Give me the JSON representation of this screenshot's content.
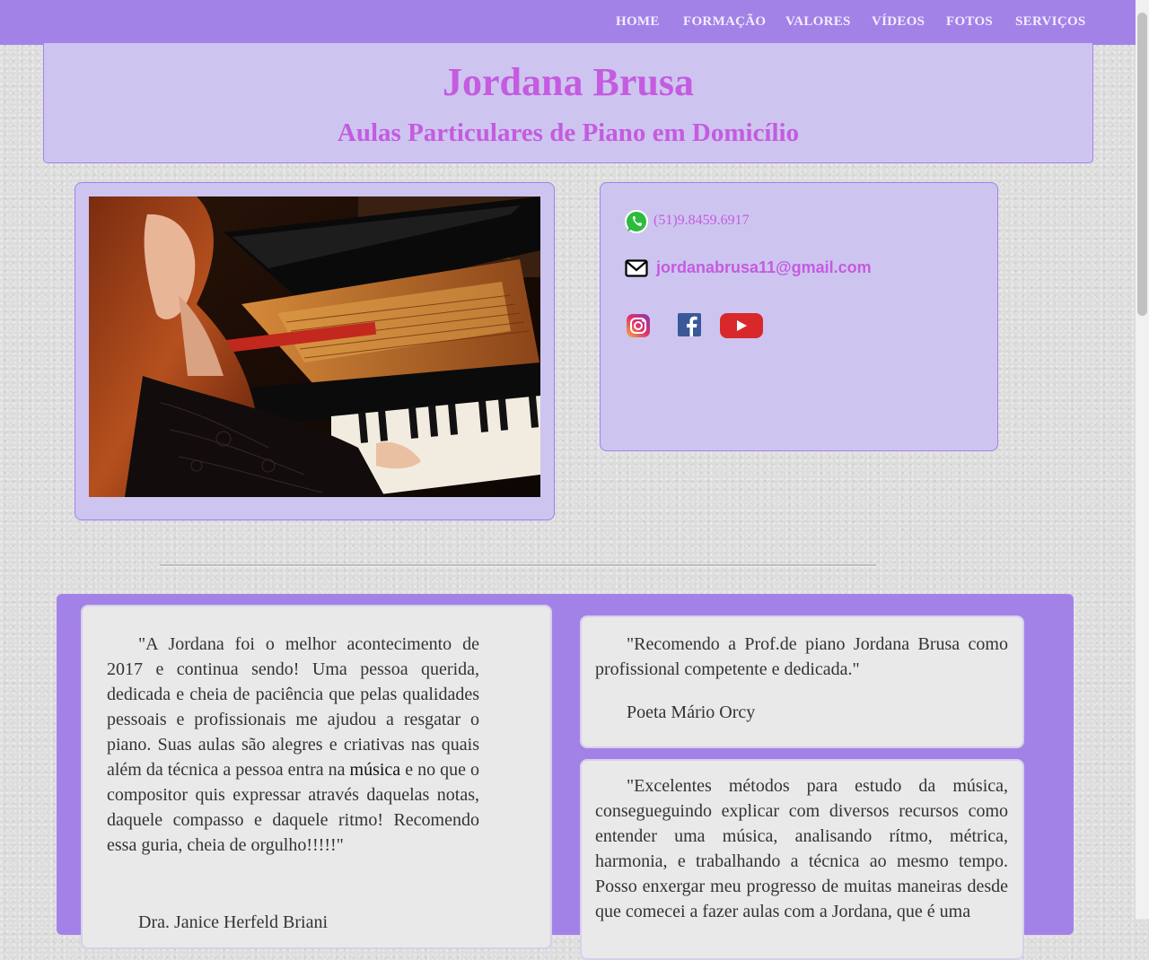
{
  "nav": {
    "items": [
      "HOME",
      "FORMAÇÃO",
      "VALORES",
      "VÍDEOS",
      "FOTOS",
      "SERVIÇOS"
    ]
  },
  "header": {
    "title": "Jordana Brusa",
    "subtitle": "Aulas Particulares de Piano em Domicílio"
  },
  "contact": {
    "phone": "(51)9.8459.6917",
    "email": "jordanabrusa11@gmail.com",
    "social_icons": [
      "instagram-icon",
      "facebook-icon",
      "youtube-icon"
    ]
  },
  "testimonials": [
    {
      "text_before": "\"A Jordana foi o melhor acontecimento de 2017 e continua sendo! Uma pessoa querida, dedicada e cheia de paciência que pelas qualidades pessoais e profissionais me ajudou a resgatar o piano. Suas aulas são alegres e criativas nas quais além da técnica a pessoa entra na",
      "link": "música",
      "text_after": "e no que o compositor quis expressar através daquelas notas, daquele compasso e daquele ritmo! Recomendo essa guria, cheia de orgulho!!!!!\"",
      "author": "Dra. Janice Herfeld Briani"
    },
    {
      "text": "\"Recomendo a Prof.de piano Jordana Brusa como profissional competente e dedicada.\"",
      "author": "Poeta Mário Orcy"
    },
    {
      "text": "\"Excelentes métodos para estudo da música, consegueguindo explicar com diversos recursos como entender uma música, analisando rítmo, métrica, harmonia, e trabalhando a técnica ao mesmo tempo. Posso enxergar meu progresso de muitas maneiras desde que comecei a fazer aulas com a Jordana, que é uma"
    }
  ],
  "colors": {
    "nav_bg": "#a382e8",
    "accent_text": "#c55be0",
    "card_bg": "#cdc5f0"
  }
}
